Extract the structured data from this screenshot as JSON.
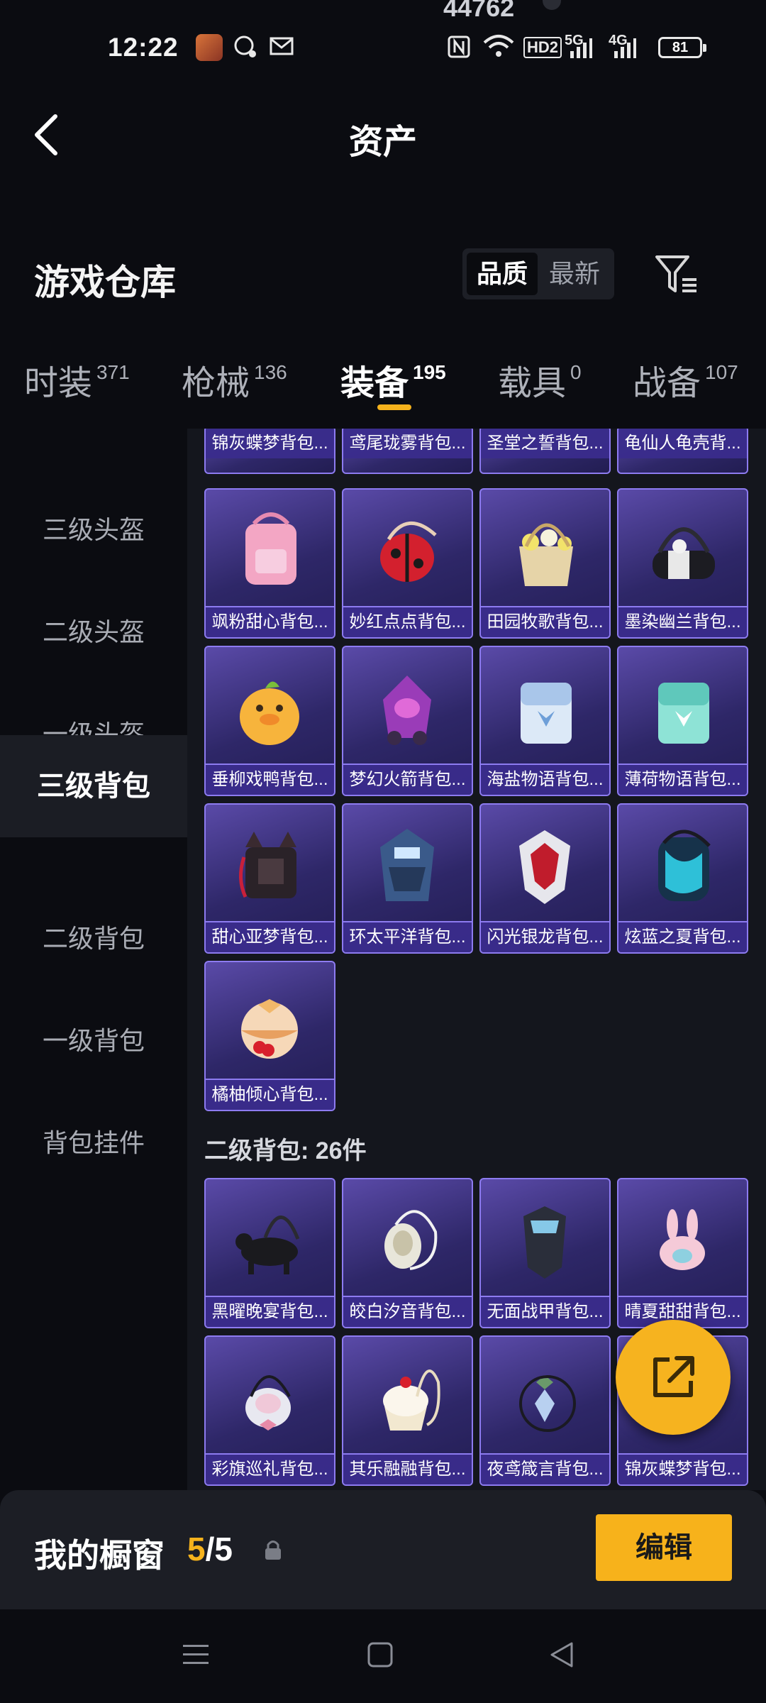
{
  "status_bar": {
    "top_number": "44762",
    "time": "12:22",
    "network_hd": "HD2",
    "network_5g": "5G",
    "network_4g": "4G",
    "battery": "81"
  },
  "header": {
    "title": "资产"
  },
  "warehouse": {
    "heading": "游戏仓库",
    "sort_options": [
      "品质",
      "最新"
    ],
    "active_sort": "品质"
  },
  "tabs": [
    {
      "label": "时装",
      "count": "371"
    },
    {
      "label": "枪械",
      "count": "136"
    },
    {
      "label": "装备",
      "count": "195"
    },
    {
      "label": "载具",
      "count": "0"
    },
    {
      "label": "战备",
      "count": "107"
    }
  ],
  "sidebar": {
    "items": [
      "三级头盔",
      "二级头盔",
      "一级头盔",
      "三级背包",
      "二级背包",
      "一级背包",
      "背包挂件"
    ],
    "active": "三级背包"
  },
  "level3_backpacks_partial": [
    "锦灰蝶梦背包...",
    "鸢尾珑雾背包...",
    "圣堂之誓背包...",
    "龟仙人龟壳背..."
  ],
  "level3_backpacks": [
    "飒粉甜心背包...",
    "妙红点点背包...",
    "田园牧歌背包...",
    "墨染幽兰背包...",
    "垂柳戏鸭背包...",
    "梦幻火箭背包...",
    "海盐物语背包...",
    "薄荷物语背包...",
    "甜心亚梦背包...",
    "环太平洋背包...",
    "闪光银龙背包...",
    "炫蓝之夏背包...",
    "橘柚倾心背包..."
  ],
  "level2_section": {
    "heading": "二级背包: 26件",
    "items": [
      "黑曜晚宴背包...",
      "皎白汐音背包...",
      "无面战甲背包...",
      "晴夏甜甜背包...",
      "彩旗巡礼背包...",
      "其乐融融背包...",
      "夜鸢箴言背包...",
      "锦灰蝶梦背包..."
    ]
  },
  "showcase": {
    "label": "我的橱窗",
    "count_current": "5",
    "count_sep": "/",
    "count_total": "5",
    "edit_label": "编辑"
  },
  "colors": {
    "accent": "#f5b21c",
    "card_border": "#8d7bf0",
    "card_bg": "#2e2768",
    "background": "#0b0c11"
  }
}
